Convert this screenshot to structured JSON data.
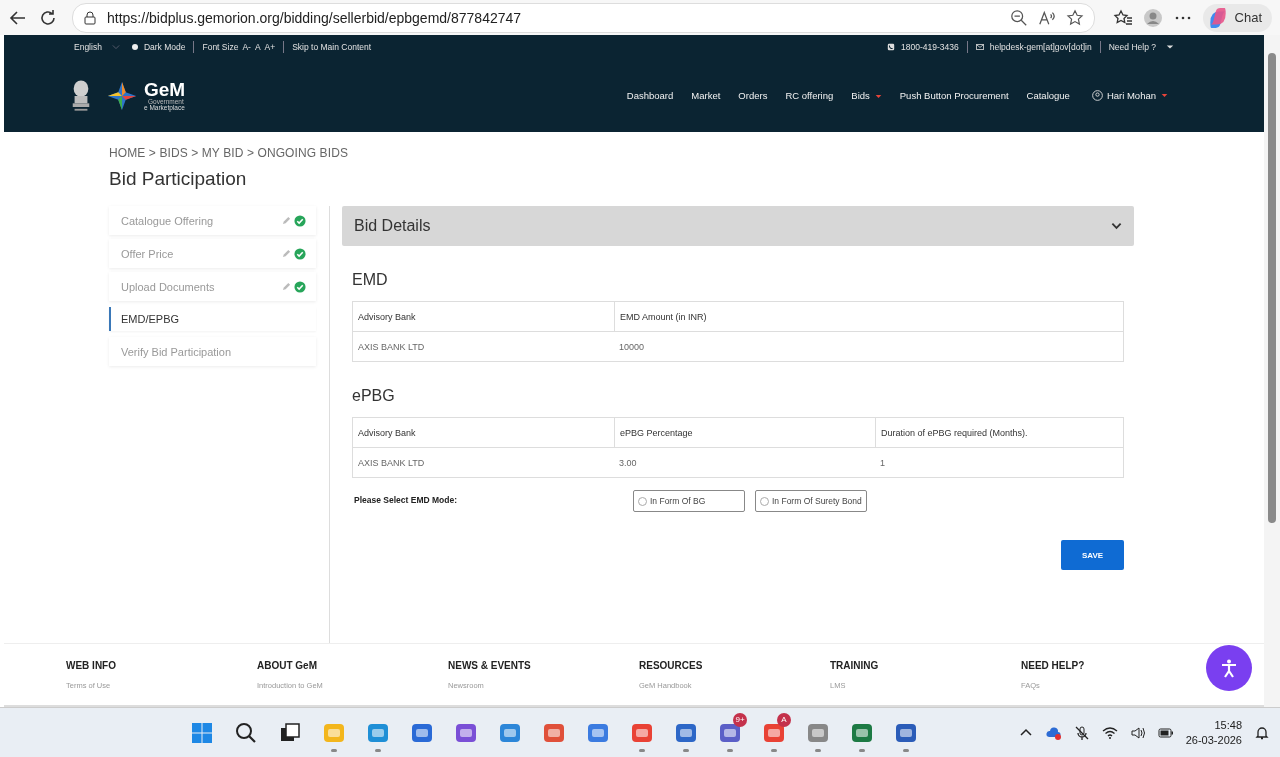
{
  "browser": {
    "url": "https://bidplus.gemorion.org/bidding/sellerbid/epbgemd/877842747",
    "chat_label": "Chat"
  },
  "top_bar": {
    "language": "English",
    "dark_mode": "Dark Mode",
    "font_size_label": "Font Size",
    "font_sizes": [
      "A-",
      "A",
      "A+"
    ],
    "skip_link": "Skip to Main Content",
    "phone": "1800-419-3436",
    "email": "helpdesk-gem[at]gov[dot]in",
    "help": "Need Help ?"
  },
  "logo": {
    "name": "GeM",
    "line1": "Government",
    "line2": "e Marketplace"
  },
  "nav": [
    {
      "label": "Dashboard",
      "dropdown": false
    },
    {
      "label": "Market",
      "dropdown": false
    },
    {
      "label": "Orders",
      "dropdown": false
    },
    {
      "label": "RC offering",
      "dropdown": false
    },
    {
      "label": "Bids",
      "dropdown": true
    },
    {
      "label": "Push Button Procurement",
      "dropdown": false
    },
    {
      "label": "Catalogue",
      "dropdown": false
    }
  ],
  "user": {
    "name": "Hari Mohan"
  },
  "breadcrumb": "HOME > BIDS > MY BID > ONGOING BIDS",
  "page_title": "Bid Participation",
  "steps": [
    {
      "label": "Catalogue Offering",
      "completed": true,
      "selected": false
    },
    {
      "label": "Offer Price",
      "completed": true,
      "selected": false
    },
    {
      "label": "Upload Documents",
      "completed": true,
      "selected": false
    },
    {
      "label": "EMD/EPBG",
      "completed": false,
      "selected": true
    },
    {
      "label": "Verify Bid Participation",
      "completed": false,
      "selected": false
    }
  ],
  "panel": {
    "title": "Bid Details",
    "expanded": false
  },
  "sections": [
    {
      "title": "EMD",
      "columns": [
        "Advisory Bank",
        "EMD Amount (in INR)"
      ],
      "rows": [
        [
          "AXIS BANK LTD",
          "10000"
        ]
      ]
    },
    {
      "title": "ePBG",
      "columns": [
        "Advisory Bank",
        "ePBG Percentage",
        "Duration of ePBG required (Months)."
      ],
      "rows": [
        [
          "AXIS BANK LTD",
          "3.00",
          "1"
        ]
      ]
    }
  ],
  "emd_mode": {
    "label": "Please Select EMD Mode:",
    "options": [
      {
        "label": "In Form Of BG",
        "selected": false
      },
      {
        "label": "In Form Of Surety Bond",
        "selected": false
      }
    ]
  },
  "save_button": "SAVE",
  "footer": [
    {
      "heading": "WEB INFO",
      "link": "Terms of Use"
    },
    {
      "heading": "ABOUT GeM",
      "link": "Introduction to GeM"
    },
    {
      "heading": "NEWS & EVENTS",
      "link": "Newsroom"
    },
    {
      "heading": "RESOURCES",
      "link": "GeM Handbook"
    },
    {
      "heading": "TRAINING",
      "link": "LMS"
    },
    {
      "heading": "NEED HELP?",
      "link": "FAQs"
    }
  ],
  "taskbar": [
    {
      "kind": "start",
      "running": false
    },
    {
      "kind": "search",
      "running": false
    },
    {
      "kind": "taskview",
      "running": false
    },
    {
      "kind": "folder",
      "running": true
    },
    {
      "kind": "browser",
      "running": true
    },
    {
      "kind": "store",
      "running": false
    },
    {
      "kind": "office",
      "running": false
    },
    {
      "kind": "chat",
      "running": false
    },
    {
      "kind": "docs",
      "running": false
    },
    {
      "kind": "calendar",
      "running": false
    },
    {
      "kind": "chrome",
      "running": true
    },
    {
      "kind": "shield",
      "running": true
    },
    {
      "kind": "teams",
      "running": true,
      "badge": "9+"
    },
    {
      "kind": "chrome",
      "running": true,
      "badge": "A"
    },
    {
      "kind": "tool",
      "running": true
    },
    {
      "kind": "excel",
      "running": true
    },
    {
      "kind": "word",
      "running": true
    }
  ],
  "clock": {
    "time": "15:48",
    "date": "26-03-2026"
  }
}
